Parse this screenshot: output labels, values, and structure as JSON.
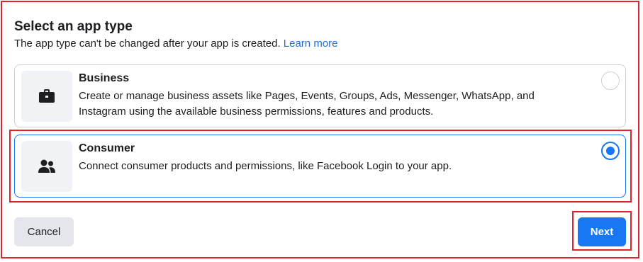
{
  "dialog": {
    "title": "Select an app type",
    "subtitle": "The app type can't be changed after your app is created.",
    "learn_more": "Learn more"
  },
  "options": [
    {
      "title": "Business",
      "description": "Create or manage business assets like Pages, Events, Groups, Ads, Messenger, WhatsApp, and Instagram using the available business permissions, features and products.",
      "icon": "briefcase-icon",
      "selected": false
    },
    {
      "title": "Consumer",
      "description": "Connect consumer products and permissions, like Facebook Login to your app.",
      "icon": "people-icon",
      "selected": true
    }
  ],
  "buttons": {
    "cancel": "Cancel",
    "next": "Next"
  },
  "colors": {
    "accent": "#1877f2",
    "highlight": "#e0232e",
    "link": "#216fdb"
  }
}
